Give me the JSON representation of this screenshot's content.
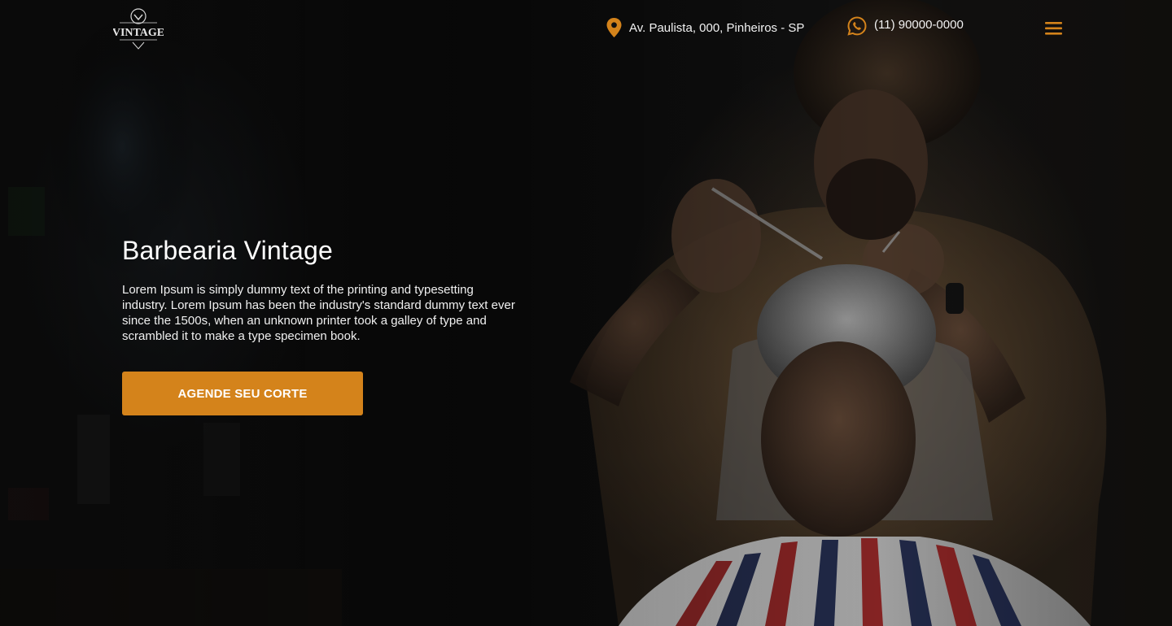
{
  "brand": {
    "logo_text": "VINTAGE",
    "icon": "barber-logo-icon"
  },
  "header": {
    "address": "Av. Paulista, 000, Pinheiros - SP",
    "address_icon": "location-pin-icon",
    "phone": "(11) 90000-0000",
    "phone_icon": "whatsapp-icon",
    "menu_icon": "hamburger-menu-icon"
  },
  "hero": {
    "title": "Barbearia Vintage",
    "description": "Lorem Ipsum is simply dummy text of the printing and typesetting industry. Lorem Ipsum has been the industry's standard dummy text ever since the 1500s, when an unknown printer took a galley of type and scrambled it to make a type specimen book.",
    "cta_label": "AGENDE SEU CORTE"
  },
  "colors": {
    "accent": "#d4831b",
    "background": "#0e0e0e",
    "text": "#ffffff"
  }
}
